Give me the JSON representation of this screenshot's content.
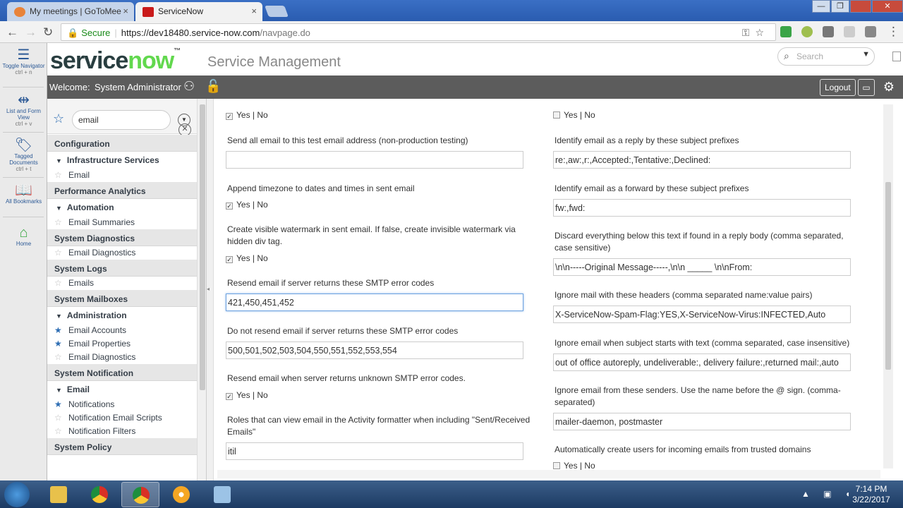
{
  "browser": {
    "tabs": [
      {
        "title": "My meetings | GoToMee",
        "close": "×"
      },
      {
        "title": "ServiceNow",
        "close": "×"
      }
    ],
    "window_controls": [
      "—",
      "❐",
      "✕"
    ],
    "secure_label": "Secure",
    "url_host": "https://dev18480.service-now.com",
    "url_path": "/navpage.do"
  },
  "rail": {
    "items": [
      {
        "label": "Toggle Navigator",
        "shortcut": "ctrl + n",
        "icon": "list-icon"
      },
      {
        "label": "List and Form View",
        "shortcut": "ctrl + v",
        "icon": "split-arrows-icon"
      },
      {
        "label": "Tagged Documents",
        "shortcut": "ctrl + t",
        "icon": "tag-icon"
      },
      {
        "label": "All Bookmarks",
        "icon": "book-icon"
      },
      {
        "label": "Home",
        "icon": "home-icon"
      }
    ]
  },
  "banner": {
    "logo_service": "service",
    "logo_now": "now",
    "app_name": "Service Management",
    "search_placeholder": "Search"
  },
  "userbar": {
    "welcome": "Welcome:",
    "user": "System Administrator",
    "logout": "Logout"
  },
  "navigator": {
    "filter_value": "email",
    "sections": [
      {
        "title": "Configuration"
      },
      {
        "group": "Infrastructure Services"
      },
      {
        "module": "Email",
        "fav": false
      },
      {
        "title": "Performance Analytics"
      },
      {
        "group": "Automation"
      },
      {
        "module": "Email Summaries",
        "fav": false
      },
      {
        "title": "System Diagnostics"
      },
      {
        "module": "Email Diagnostics",
        "fav": false
      },
      {
        "title": "System Logs"
      },
      {
        "module": "Emails",
        "fav": false
      },
      {
        "title": "System Mailboxes"
      },
      {
        "group": "Administration"
      },
      {
        "module": "Email Accounts",
        "fav": true
      },
      {
        "module": "Email Properties",
        "fav": true
      },
      {
        "module": "Email Diagnostics",
        "fav": false
      },
      {
        "title": "System Notification"
      },
      {
        "group": "Email"
      },
      {
        "module": "Notifications",
        "fav": true
      },
      {
        "module": "Notification Email Scripts",
        "fav": false
      },
      {
        "module": "Notification Filters",
        "fav": false
      },
      {
        "title": "System Policy"
      }
    ]
  },
  "form": {
    "yes_no": "Yes | No",
    "left": {
      "top_checkbox": {
        "checked": true
      },
      "f1_label": "Send all email to this test email address (non-production testing)",
      "f1_value": "",
      "f2_label": "Append timezone to dates and times in sent email",
      "f2_checked": true,
      "f3_label": "Create visible watermark in sent email. If false, create invisible watermark via hidden div tag.",
      "f3_checked": true,
      "f4_label": "Resend email if server returns these SMTP error codes",
      "f4_value": "421,450,451,452",
      "f5_label": "Do not resend email if server returns these SMTP error codes",
      "f5_value": "500,501,502,503,504,550,551,552,553,554",
      "f6_label": "Resend email when server returns unknown SMTP error codes.",
      "f6_checked": true,
      "f7_label": "Roles that can view email in the Activity formatter when including \"Sent/Received Emails\"",
      "f7_value": "itil"
    },
    "right": {
      "top_checkbox": {
        "checked": false
      },
      "r1_label": "Identify email as a reply by these subject prefixes",
      "r1_value": "re:,aw:,r:,Accepted:,Tentative:,Declined:",
      "r2_label": "Identify email as a forward by these subject prefixes",
      "r2_value": "fw:,fwd:",
      "r3_label": "Discard everything below this text if found in a reply body (comma separated, case sensitive)",
      "r3_value": "\\n\\n-----Original Message-----,\\n\\n _____  \\n\\nFrom:",
      "r4_label": "Ignore mail with these headers (comma separated name:value pairs)",
      "r4_value": "X-ServiceNow-Spam-Flag:YES,X-ServiceNow-Virus:INFECTED,Auto",
      "r5_label": "Ignore email when subject starts with text (comma separated, case insensitive)",
      "r5_value": "out of office autoreply, undeliverable:, delivery failure:,returned mail:,auto",
      "r6_label": "Ignore email from these senders. Use the name before the @ sign. (comma-separated)",
      "r6_value": "mailer-daemon, postmaster",
      "r7_label": "Automatically create users for incoming emails from trusted domains",
      "r7_checked": false
    }
  },
  "taskbar": {
    "time": "7:14 PM",
    "date": "3/22/2017"
  }
}
